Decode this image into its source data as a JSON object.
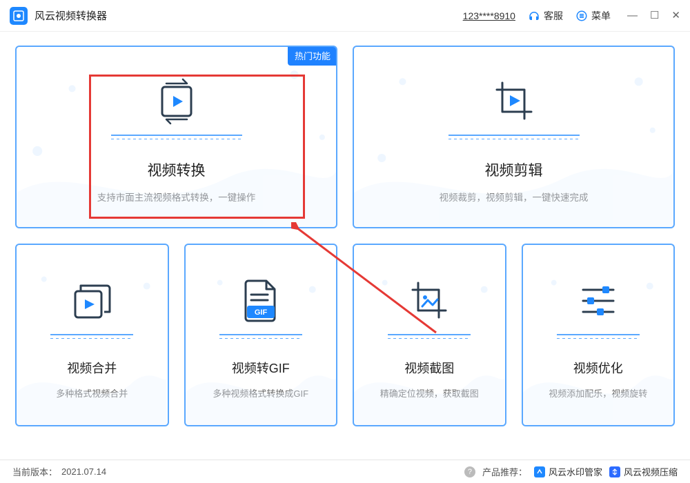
{
  "titlebar": {
    "app_name": "风云视频转换器",
    "user_id": "123****8910",
    "service_label": "客服",
    "menu_label": "菜单"
  },
  "hot_badge": "热门功能",
  "cards": {
    "convert": {
      "title": "视频转换",
      "desc": "支持市面主流视频格式转换，一键操作"
    },
    "edit": {
      "title": "视频剪辑",
      "desc": "视频裁剪，视频剪辑，一键快速完成"
    },
    "merge": {
      "title": "视频合并",
      "desc": "多种格式视频合并"
    },
    "gif": {
      "title": "视频转GIF",
      "desc": "多种视频格式转换成GIF",
      "badge": "GIF"
    },
    "screenshot": {
      "title": "视频截图",
      "desc": "精确定位视频，获取截图"
    },
    "optimize": {
      "title": "视频优化",
      "desc": "视频添加配乐，视频旋转"
    }
  },
  "footer": {
    "version_label": "当前版本：",
    "version_value": "2021.07.14",
    "recommend_label": "产品推荐：",
    "rec1": "风云水印管家",
    "rec2": "风云视频压缩"
  }
}
